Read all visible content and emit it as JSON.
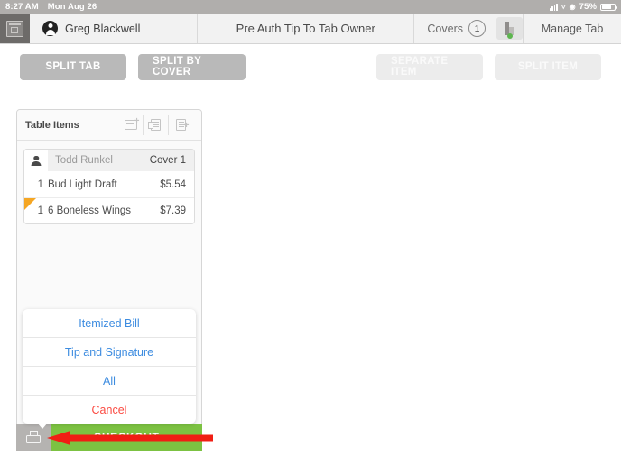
{
  "status_bar": {
    "time": "8:27 AM",
    "date": "Mon Aug 26",
    "battery_percent": "75%",
    "signal_icon": "cellular-signal-icon",
    "wifi_icon": "wifi-icon",
    "lock_icon": "rotation-lock-icon",
    "battery_icon": "battery-icon"
  },
  "nav_bar": {
    "tables_icon": "tables-grid-icon",
    "user_avatar_icon": "user-avatar-icon",
    "user_name": "Greg Blackwell",
    "title": "Pre Auth Tip To Tab Owner",
    "covers_label": "Covers",
    "covers_count": "1",
    "toggle_icon": "split-view-toggle-icon",
    "toggle_status_color": "#5db54f",
    "manage_tab_label": "Manage Tab"
  },
  "split_buttons": [
    {
      "label": "SPLIT TAB",
      "state": "enabled",
      "name": "split-tab-button"
    },
    {
      "label": "SPLIT BY COVER",
      "state": "enabled",
      "name": "split-by-cover-button"
    },
    {
      "label": "SEPARATE ITEM",
      "state": "disabled",
      "name": "separate-item-button"
    },
    {
      "label": "SPLIT ITEM",
      "state": "disabled",
      "name": "split-item-button"
    }
  ],
  "panel": {
    "title": "Table Items",
    "icons": [
      {
        "name": "add-cover-icon",
        "glyph": "card-plus"
      },
      {
        "name": "move-item-icon",
        "glyph": "receipt-arrow"
      },
      {
        "name": "add-receipt-icon",
        "glyph": "receipt-plus"
      }
    ],
    "cover": {
      "avatar_icon": "cover-person-icon",
      "guest_name": "Todd Runkel",
      "cover_label": "Cover 1",
      "items": [
        {
          "qty": "1",
          "name": "Bud Light Draft",
          "price": "$5.54",
          "flagged": false
        },
        {
          "qty": "1",
          "name": "6 Boneless Wings",
          "price": "$7.39",
          "flagged": true
        }
      ]
    }
  },
  "action_sheet": {
    "items": [
      {
        "label": "Itemized Bill",
        "style": "default",
        "name": "action-itemized-bill"
      },
      {
        "label": "Tip and Signature",
        "style": "default",
        "name": "action-tip-and-signature"
      },
      {
        "label": "All",
        "style": "default",
        "name": "action-all"
      },
      {
        "label": "Cancel",
        "style": "destructive",
        "name": "action-cancel"
      }
    ],
    "default_color": "#3d8ce0",
    "destructive_color": "#fb4b42"
  },
  "bottom_bar": {
    "print_icon": "printer-icon",
    "checkout_label": "CHECKOUT",
    "checkout_color": "#7cc242"
  },
  "annotation": {
    "arrow_color": "#f01e14",
    "arrow_direction": "left",
    "points_at": "printer-icon"
  }
}
